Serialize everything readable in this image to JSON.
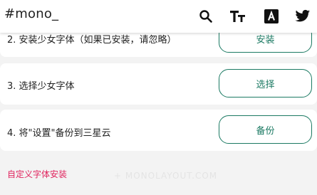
{
  "header": {
    "brand": "#mono_",
    "icons": [
      "search-icon",
      "text-size-icon",
      "font-style-icon",
      "twitter-icon"
    ]
  },
  "steps": [
    {
      "label": "2. 安装少女字体（如果已安装，请忽略）",
      "button": "安装"
    },
    {
      "label": "3. 选择少女字体",
      "button": "选择"
    },
    {
      "label": "4. 将\"设置\"备份到三星云",
      "button": "备份"
    }
  ],
  "custom_font_link": "自定义字体安装",
  "watermark": "+ MONOLAYOUT.COM",
  "colors": {
    "accent": "#1c7a63",
    "link": "#e0245e",
    "background": "#f3f3f3"
  }
}
